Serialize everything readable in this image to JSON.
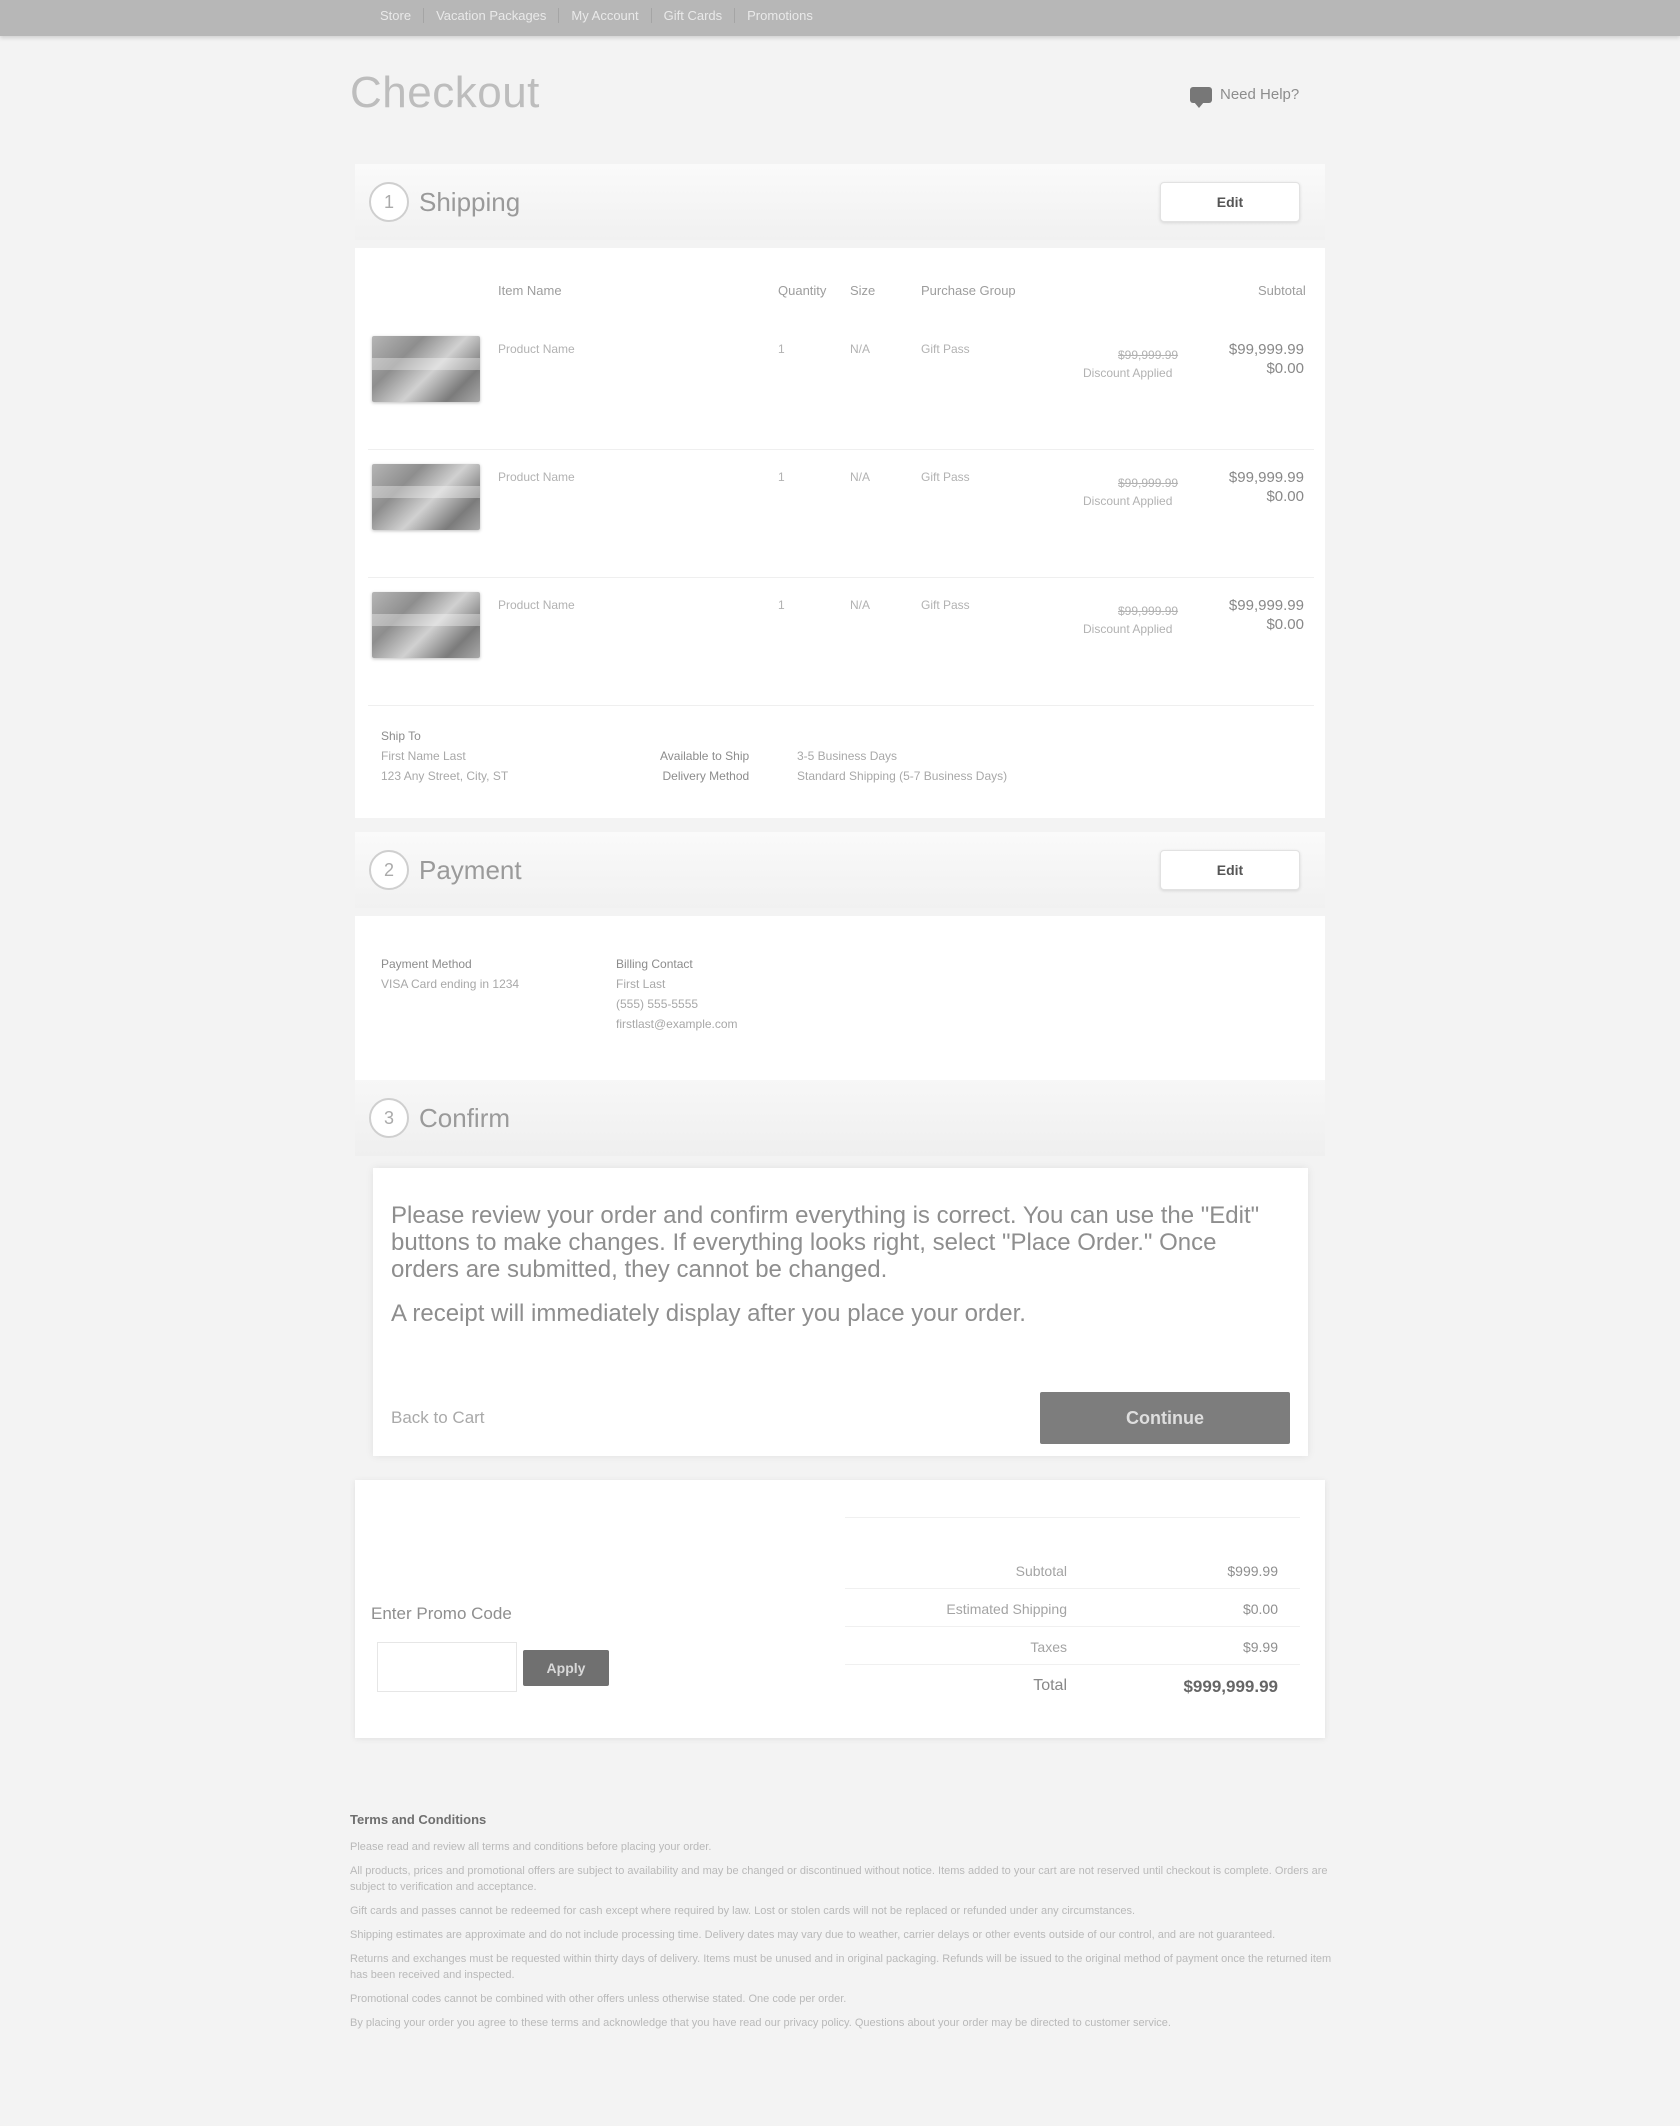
{
  "nav": {
    "items": [
      "Store",
      "Vacation Packages",
      "My Account",
      "Gift Cards",
      "Promotions"
    ]
  },
  "page": {
    "title": "Checkout",
    "help_label": "Need Help?"
  },
  "shipping": {
    "step": "1",
    "title": "Shipping",
    "edit_label": "Edit",
    "columns": {
      "item_name": "Item Name",
      "quantity": "Quantity",
      "size": "Size",
      "purchase_group": "Purchase Group",
      "subtotal": "Subtotal"
    },
    "items": [
      {
        "name": "Product Name",
        "qty": "1",
        "size": "N/A",
        "group": "Gift Pass",
        "orig_price": "$99,999.99",
        "discount": "Discount Applied",
        "price": "$99,999.99",
        "price_sub": "$0.00"
      },
      {
        "name": "Product Name",
        "qty": "1",
        "size": "N/A",
        "group": "Gift Pass",
        "orig_price": "$99,999.99",
        "discount": "Discount Applied",
        "price": "$99,999.99",
        "price_sub": "$0.00"
      },
      {
        "name": "Product Name",
        "qty": "1",
        "size": "N/A",
        "group": "Gift Pass",
        "orig_price": "$99,999.99",
        "discount": "Discount Applied",
        "price": "$99,999.99",
        "price_sub": "$0.00"
      }
    ],
    "ship_to_label": "Ship To",
    "ship_to_name": "First Name Last",
    "ship_to_address": "123 Any Street, City, ST",
    "available_label": "Available to Ship",
    "delivery_label": "Delivery Method",
    "available_value": "3-5 Business Days",
    "delivery_value": "Standard Shipping (5-7 Business Days)"
  },
  "payment": {
    "step": "2",
    "title": "Payment",
    "edit_label": "Edit",
    "method_label": "Payment Method",
    "method_value": "VISA Card ending in 1234",
    "billing_label": "Billing Contact",
    "billing_name": "First Last",
    "billing_phone": "(555) 555-5555",
    "billing_email": "firstlast@example.com"
  },
  "confirm": {
    "step": "3",
    "title": "Confirm",
    "message": "Please review your order and confirm everything is correct. You can use the \"Edit\" buttons to make changes. If everything looks right, select \"Place Order.\" Once orders are submitted, they cannot be changed.",
    "receipt_note": "A receipt will immediately display after you place your order.",
    "back_label": "Back to Cart",
    "continue_label": "Continue"
  },
  "summary": {
    "promo_label": "Enter Promo Code",
    "promo_placeholder": "",
    "apply_label": "Apply",
    "rows": [
      {
        "label": "Subtotal",
        "value": "$999.99"
      },
      {
        "label": "Estimated Shipping",
        "value": "$0.00"
      },
      {
        "label": "Taxes",
        "value": "$9.99"
      }
    ],
    "total_label": "Total",
    "total_value": "$999,999.99"
  },
  "terms": {
    "title": "Terms and Conditions",
    "paragraphs": [
      "Please read and review all terms and conditions before placing your order.",
      "All products, prices and promotional offers are subject to availability and may be changed or discontinued without notice. Items added to your cart are not reserved until checkout is complete. Orders are subject to verification and acceptance.",
      "Gift cards and passes cannot be redeemed for cash except where required by law. Lost or stolen cards will not be replaced or refunded under any circumstances.",
      "Shipping estimates are approximate and do not include processing time. Delivery dates may vary due to weather, carrier delays or other events outside of our control, and are not guaranteed.",
      "Returns and exchanges must be requested within thirty days of delivery. Items must be unused and in original packaging. Refunds will be issued to the original method of payment once the returned item has been received and inspected.",
      "Promotional codes cannot be combined with other offers unless otherwise stated. One code per order.",
      "By placing your order you agree to these terms and acknowledge that you have read our privacy policy. Questions about your order may be directed to customer service."
    ]
  }
}
